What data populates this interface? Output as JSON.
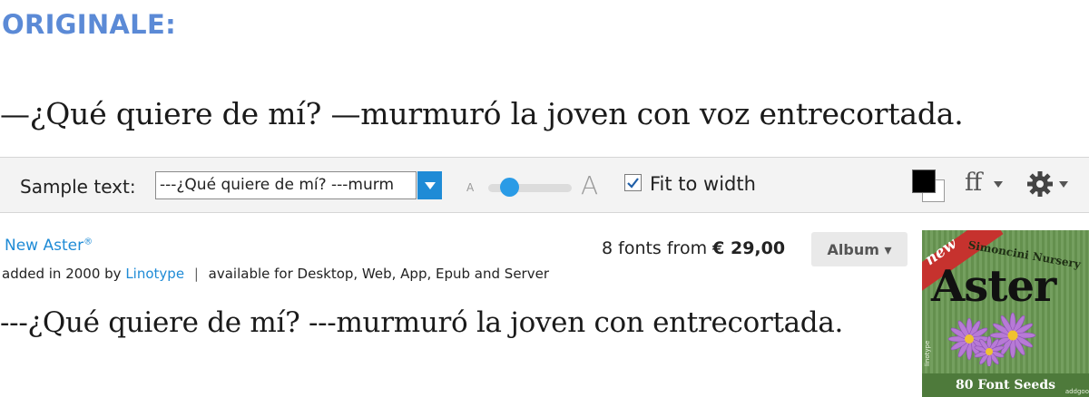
{
  "original": {
    "label": "ORIGINALE:",
    "text": "—¿Qué quiere de mí? —murmuró la joven con voz entrecortada."
  },
  "toolbar": {
    "sample_label": "Sample text:",
    "sample_value": "---¿Qué quiere de mí? ---murm",
    "size_small": "A",
    "size_big": "A",
    "fit_checked": true,
    "fit_label": "Fit to width",
    "text_color": "#000000",
    "background_color": "#ffffff",
    "ff_label": "ff",
    "slider_level": 0.18
  },
  "font": {
    "name": "New Aster",
    "reg": "®",
    "added_prefix": "added in 2000 by",
    "foundry": "Linotype",
    "separator": "|",
    "availability": "available for Desktop, Web, App, Epub and Server",
    "price_prefix": "8 fonts from",
    "price": "€ 29,00",
    "album_label": "Album ▾",
    "preview": "---¿Qué quiere de mí? ---murmuró la joven con entrecortada."
  },
  "cover": {
    "badge": "new",
    "nursery": "Simoncini Nursery",
    "title": "Aster",
    "seeds": "80 Font Seeds",
    "side_left": "linotype",
    "side_right": "addgoo"
  },
  "colors": {
    "accent_blue": "#1f8bd6",
    "label_blue": "#5b8ad6"
  },
  "icons": {
    "dropdown": "chevron-down-icon",
    "checkbox": "checkmark-icon",
    "gear": "gear-icon"
  }
}
